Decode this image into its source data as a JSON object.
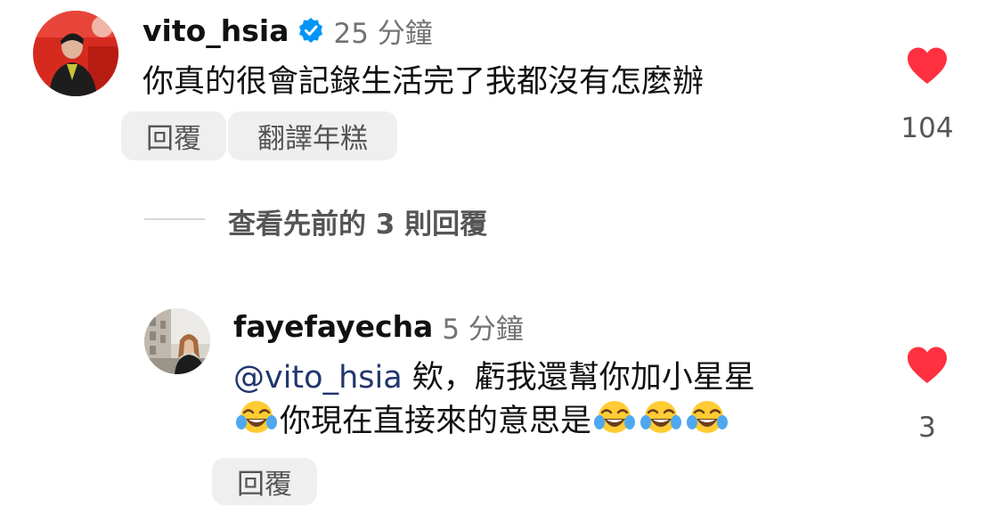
{
  "comments": [
    {
      "username": "vito_hsia",
      "verified": true,
      "time": "25 分鐘",
      "text": "你真的很會記錄生活完了我都沒有怎麼辦",
      "reply_label": "回覆",
      "translate_label": "翻譯年糕",
      "likes": "104"
    }
  ],
  "view_replies_label": "查看先前的 3 則回覆",
  "reply": {
    "username": "fayefayecha",
    "time": "5 分鐘",
    "mention": "@vito_hsia",
    "line1_text": " 欸，虧我還幫你加小星星",
    "line2_text": "你現在直接來的意思是",
    "reply_label": "回覆",
    "likes": "3"
  },
  "emoji_name": "face-with-tears-of-joy",
  "colors": {
    "heart": "#ff3040",
    "verified": "#0095f6",
    "mention": "#21366e",
    "muted": "#737373"
  }
}
